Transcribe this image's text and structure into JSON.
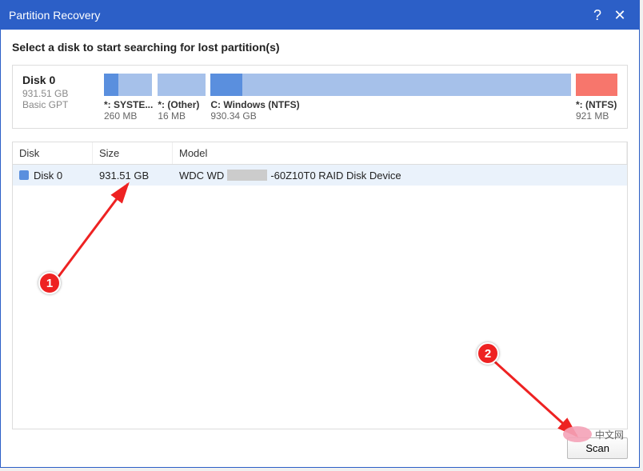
{
  "window": {
    "title": "Partition Recovery"
  },
  "instruction": "Select a disk to start searching for lost partition(s)",
  "disk_card": {
    "name": "Disk 0",
    "size": "931.51 GB",
    "type": "Basic GPT",
    "partitions": [
      {
        "label": "*: SYSTE...",
        "size": "260 MB"
      },
      {
        "label": "*: (Other)",
        "size": "16 MB"
      },
      {
        "label": "C: Windows (NTFS)",
        "size": "930.34 GB"
      },
      {
        "label": "*: (NTFS)",
        "size": "921 MB"
      }
    ]
  },
  "table": {
    "headers": {
      "disk": "Disk",
      "size": "Size",
      "model": "Model"
    },
    "rows": [
      {
        "disk": "Disk 0",
        "size": "931.51 GB",
        "model_prefix": "WDC WD",
        "model_suffix": "-60Z10T0 RAID Disk Device"
      }
    ]
  },
  "buttons": {
    "scan": "Scan"
  },
  "annotations": {
    "one": "1",
    "two": "2"
  },
  "watermark": "中文网"
}
